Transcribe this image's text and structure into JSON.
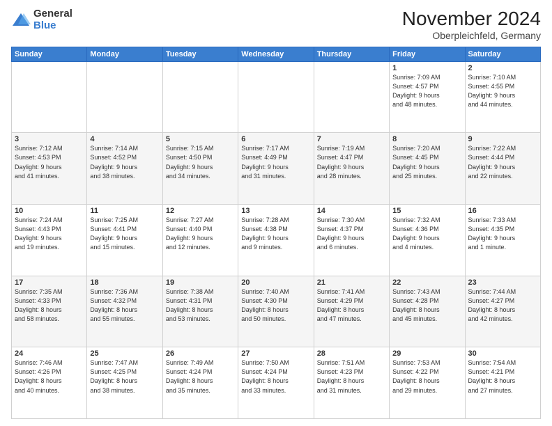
{
  "logo": {
    "general": "General",
    "blue": "Blue"
  },
  "title": {
    "month_year": "November 2024",
    "location": "Oberpleichfeld, Germany"
  },
  "days_of_week": [
    "Sunday",
    "Monday",
    "Tuesday",
    "Wednesday",
    "Thursday",
    "Friday",
    "Saturday"
  ],
  "weeks": [
    [
      {
        "day": "",
        "info": ""
      },
      {
        "day": "",
        "info": ""
      },
      {
        "day": "",
        "info": ""
      },
      {
        "day": "",
        "info": ""
      },
      {
        "day": "",
        "info": ""
      },
      {
        "day": "1",
        "info": "Sunrise: 7:09 AM\nSunset: 4:57 PM\nDaylight: 9 hours\nand 48 minutes."
      },
      {
        "day": "2",
        "info": "Sunrise: 7:10 AM\nSunset: 4:55 PM\nDaylight: 9 hours\nand 44 minutes."
      }
    ],
    [
      {
        "day": "3",
        "info": "Sunrise: 7:12 AM\nSunset: 4:53 PM\nDaylight: 9 hours\nand 41 minutes."
      },
      {
        "day": "4",
        "info": "Sunrise: 7:14 AM\nSunset: 4:52 PM\nDaylight: 9 hours\nand 38 minutes."
      },
      {
        "day": "5",
        "info": "Sunrise: 7:15 AM\nSunset: 4:50 PM\nDaylight: 9 hours\nand 34 minutes."
      },
      {
        "day": "6",
        "info": "Sunrise: 7:17 AM\nSunset: 4:49 PM\nDaylight: 9 hours\nand 31 minutes."
      },
      {
        "day": "7",
        "info": "Sunrise: 7:19 AM\nSunset: 4:47 PM\nDaylight: 9 hours\nand 28 minutes."
      },
      {
        "day": "8",
        "info": "Sunrise: 7:20 AM\nSunset: 4:45 PM\nDaylight: 9 hours\nand 25 minutes."
      },
      {
        "day": "9",
        "info": "Sunrise: 7:22 AM\nSunset: 4:44 PM\nDaylight: 9 hours\nand 22 minutes."
      }
    ],
    [
      {
        "day": "10",
        "info": "Sunrise: 7:24 AM\nSunset: 4:43 PM\nDaylight: 9 hours\nand 19 minutes."
      },
      {
        "day": "11",
        "info": "Sunrise: 7:25 AM\nSunset: 4:41 PM\nDaylight: 9 hours\nand 15 minutes."
      },
      {
        "day": "12",
        "info": "Sunrise: 7:27 AM\nSunset: 4:40 PM\nDaylight: 9 hours\nand 12 minutes."
      },
      {
        "day": "13",
        "info": "Sunrise: 7:28 AM\nSunset: 4:38 PM\nDaylight: 9 hours\nand 9 minutes."
      },
      {
        "day": "14",
        "info": "Sunrise: 7:30 AM\nSunset: 4:37 PM\nDaylight: 9 hours\nand 6 minutes."
      },
      {
        "day": "15",
        "info": "Sunrise: 7:32 AM\nSunset: 4:36 PM\nDaylight: 9 hours\nand 4 minutes."
      },
      {
        "day": "16",
        "info": "Sunrise: 7:33 AM\nSunset: 4:35 PM\nDaylight: 9 hours\nand 1 minute."
      }
    ],
    [
      {
        "day": "17",
        "info": "Sunrise: 7:35 AM\nSunset: 4:33 PM\nDaylight: 8 hours\nand 58 minutes."
      },
      {
        "day": "18",
        "info": "Sunrise: 7:36 AM\nSunset: 4:32 PM\nDaylight: 8 hours\nand 55 minutes."
      },
      {
        "day": "19",
        "info": "Sunrise: 7:38 AM\nSunset: 4:31 PM\nDaylight: 8 hours\nand 53 minutes."
      },
      {
        "day": "20",
        "info": "Sunrise: 7:40 AM\nSunset: 4:30 PM\nDaylight: 8 hours\nand 50 minutes."
      },
      {
        "day": "21",
        "info": "Sunrise: 7:41 AM\nSunset: 4:29 PM\nDaylight: 8 hours\nand 47 minutes."
      },
      {
        "day": "22",
        "info": "Sunrise: 7:43 AM\nSunset: 4:28 PM\nDaylight: 8 hours\nand 45 minutes."
      },
      {
        "day": "23",
        "info": "Sunrise: 7:44 AM\nSunset: 4:27 PM\nDaylight: 8 hours\nand 42 minutes."
      }
    ],
    [
      {
        "day": "24",
        "info": "Sunrise: 7:46 AM\nSunset: 4:26 PM\nDaylight: 8 hours\nand 40 minutes."
      },
      {
        "day": "25",
        "info": "Sunrise: 7:47 AM\nSunset: 4:25 PM\nDaylight: 8 hours\nand 38 minutes."
      },
      {
        "day": "26",
        "info": "Sunrise: 7:49 AM\nSunset: 4:24 PM\nDaylight: 8 hours\nand 35 minutes."
      },
      {
        "day": "27",
        "info": "Sunrise: 7:50 AM\nSunset: 4:24 PM\nDaylight: 8 hours\nand 33 minutes."
      },
      {
        "day": "28",
        "info": "Sunrise: 7:51 AM\nSunset: 4:23 PM\nDaylight: 8 hours\nand 31 minutes."
      },
      {
        "day": "29",
        "info": "Sunrise: 7:53 AM\nSunset: 4:22 PM\nDaylight: 8 hours\nand 29 minutes."
      },
      {
        "day": "30",
        "info": "Sunrise: 7:54 AM\nSunset: 4:21 PM\nDaylight: 8 hours\nand 27 minutes."
      }
    ]
  ]
}
